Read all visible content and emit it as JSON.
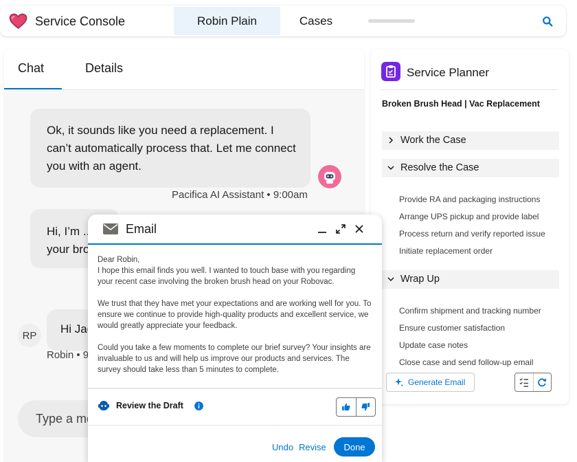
{
  "app": {
    "title": "Service Console",
    "brand_color": "#0176d3",
    "heart_color": "#e3456e"
  },
  "nav": {
    "tabs": [
      {
        "label": "Robin Plain",
        "active": true
      },
      {
        "label": "Cases",
        "active": false
      }
    ],
    "search_icon": "search-icon"
  },
  "chat": {
    "tabs": [
      {
        "label": "Chat",
        "active": true
      },
      {
        "label": "Details",
        "active": false
      }
    ],
    "messages": [
      {
        "text": "Ok, it sounds like you need a replacement. I can’t automatically process that. Let me connect you with an agent.",
        "meta": "Pacifica AI Assistant • 9:00am"
      },
      {
        "text": "Hi, I’m ... your bro"
      },
      {
        "text": "Hi Jac",
        "avatar": "RP",
        "meta": "Robin • 9"
      }
    ],
    "input_placeholder": "Type a me"
  },
  "planner": {
    "title": "Service Planner",
    "subject": "Broken Brush Head | Vac Replacement",
    "sections": [
      {
        "label": "Work the Case",
        "expanded": false,
        "tasks": []
      },
      {
        "label": "Resolve the Case",
        "expanded": true,
        "tasks": [
          "Provide RA and packaging instructions",
          "Arrange UPS pickup and provide label",
          "Process return and verify reported issue",
          "Initiate replacement order"
        ]
      },
      {
        "label": "Wrap Up",
        "expanded": true,
        "tasks": [
          "Confirm shipment and tracking number",
          "Ensure customer satisfaction",
          "Update case notes",
          "Close case and send follow-up email"
        ]
      }
    ],
    "generate_label": "Generate Email"
  },
  "email": {
    "title": "Email",
    "greeting": "Dear Robin,",
    "paragraphs": [
      "I hope this email finds you well. I wanted to touch base with you regarding your recent case involving the broken brush head on your Robovac.",
      "We trust that they have met your expectations and are working well for you. To ensure we continue to provide high-quality products and excellent service, we would greatly appreciate your feedback.",
      "Could you take a few moments to complete our brief survey? Your insights are invaluable to us and will help us improve our products and services. The survey should take less than 5 minutes to complete."
    ],
    "review_label": "Review the Draft",
    "undo_label": "Undo",
    "revise_label": "Revise",
    "done_label": "Done"
  }
}
